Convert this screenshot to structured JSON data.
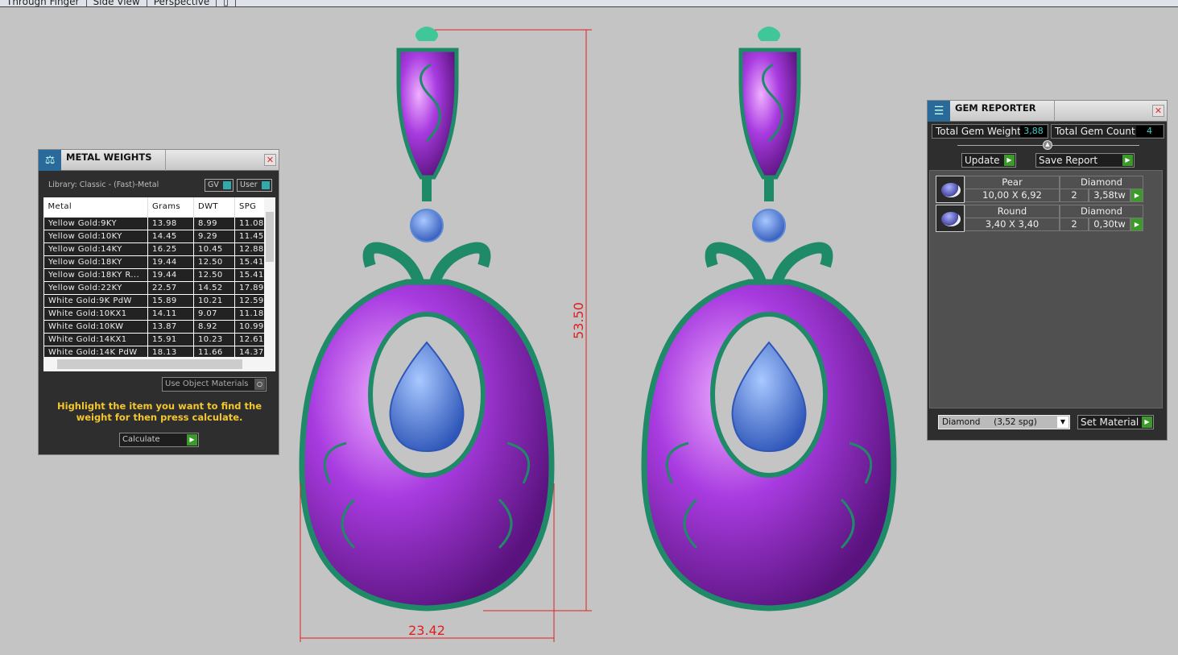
{
  "tabs": [
    "Through Finger",
    "Side View",
    "Perspective",
    "▯"
  ],
  "dimensions": {
    "height": "53.50",
    "width": "23.42"
  },
  "metal_weights": {
    "title": "METAL WEIGHTS",
    "library": "Library: Classic - (Fast)-Metal",
    "gv_label": "GV",
    "user_label": "User",
    "columns": [
      "Metal",
      "Grams",
      "DWT",
      "SPG"
    ],
    "rows": [
      [
        "Yellow Gold:9KY",
        "13.98",
        "8.99",
        "11.08"
      ],
      [
        "Yellow Gold:10KY",
        "14.45",
        "9.29",
        "11.45"
      ],
      [
        "Yellow Gold:14KY",
        "16.25",
        "10.45",
        "12.88"
      ],
      [
        "Yellow Gold:18KY",
        "19.44",
        "12.50",
        "15.41"
      ],
      [
        "Yellow Gold:18KY R...",
        "19.44",
        "12.50",
        "15.41"
      ],
      [
        "Yellow Gold:22KY",
        "22.57",
        "14.52",
        "17.89"
      ],
      [
        "White Gold:9K PdW",
        "15.89",
        "10.21",
        "12.59"
      ],
      [
        "White Gold:10KX1",
        "14.11",
        "9.07",
        "11.18"
      ],
      [
        "White Gold:10KW",
        "13.87",
        "8.92",
        "10.99"
      ],
      [
        "White Gold:14KX1",
        "15.91",
        "10.23",
        "12.61"
      ],
      [
        "White Gold:14K PdW",
        "18.13",
        "11.66",
        "14.37"
      ]
    ],
    "use_object_materials": "Use Object Materials",
    "hint": "Highlight the item you want to find the weight for then press calculate.",
    "calculate": "Calculate"
  },
  "gem_reporter": {
    "title": "GEM REPORTER",
    "total_weight_label": "Total Gem Weight",
    "total_weight": "3,88",
    "total_count_label": "Total Gem Count",
    "total_count": "4",
    "update": "Update",
    "save_report": "Save Report",
    "gems": [
      {
        "shape": "Pear",
        "material": "Diamond",
        "size": "10,00 X 6,92",
        "count": "2",
        "weight": "3,58tw"
      },
      {
        "shape": "Round",
        "material": "Diamond",
        "size": "3,40 X 3,40",
        "count": "2",
        "weight": "0,30tw"
      }
    ],
    "material_select": "Diamond     (3,52 spg)",
    "set_material": "Set Material"
  },
  "colors": {
    "metal_purple": "#9b2fd0",
    "accent_green": "#1f8a68",
    "gem_blue": "#4a78d8",
    "dimension_red": "#e02020"
  }
}
